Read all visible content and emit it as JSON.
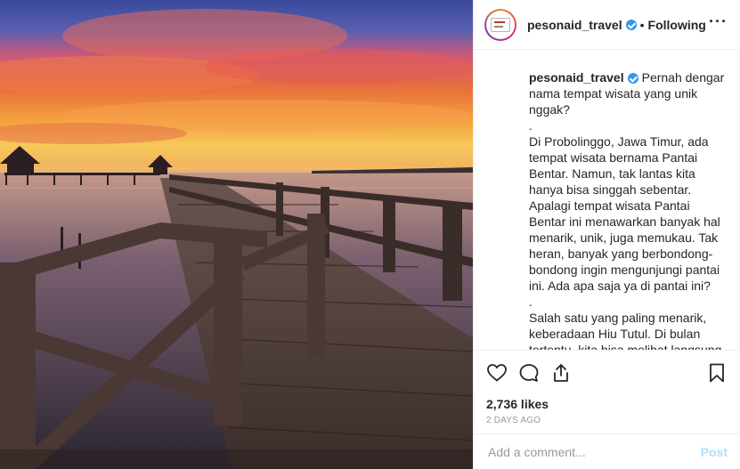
{
  "header": {
    "username": "pesonaid_travel",
    "separator": "•",
    "follow_status": "Following",
    "more_label": "···"
  },
  "caption": {
    "username": "pesonaid_travel",
    "text": "Pernah dengar nama tempat wisata yang unik nggak?\n.\nDi Probolinggo, Jawa Timur, ada tempat wisata bernama Pantai Bentar. Namun, tak lantas kita hanya bisa singgah sebentar. Apalagi tempat wisata Pantai Bentar ini menawarkan banyak hal menarik, unik, juga memukau. Tak heran, banyak yang berbondong-bondong ingin mengunjungi pantai ini. Ada apa saja ya di pantai ini?\n.\nSalah satu yang paling menarik, keberadaan Hiu Tutul. Di bulan tertentu, kita bisa melihat langsung Hiu Tutul dari jarak dekat, menarik bukan? Nah, bisa"
  },
  "actions": {
    "icons": [
      "heart-icon",
      "comment-icon",
      "share-icon",
      "bookmark-icon"
    ]
  },
  "likes": "2,736 likes",
  "date": "2 DAYS AGO",
  "comment": {
    "placeholder": "Add a comment...",
    "post_label": "Post"
  },
  "colors": {
    "verified": "#3897f0",
    "post_disabled": "#b2dffc",
    "meta_text": "#999999"
  }
}
